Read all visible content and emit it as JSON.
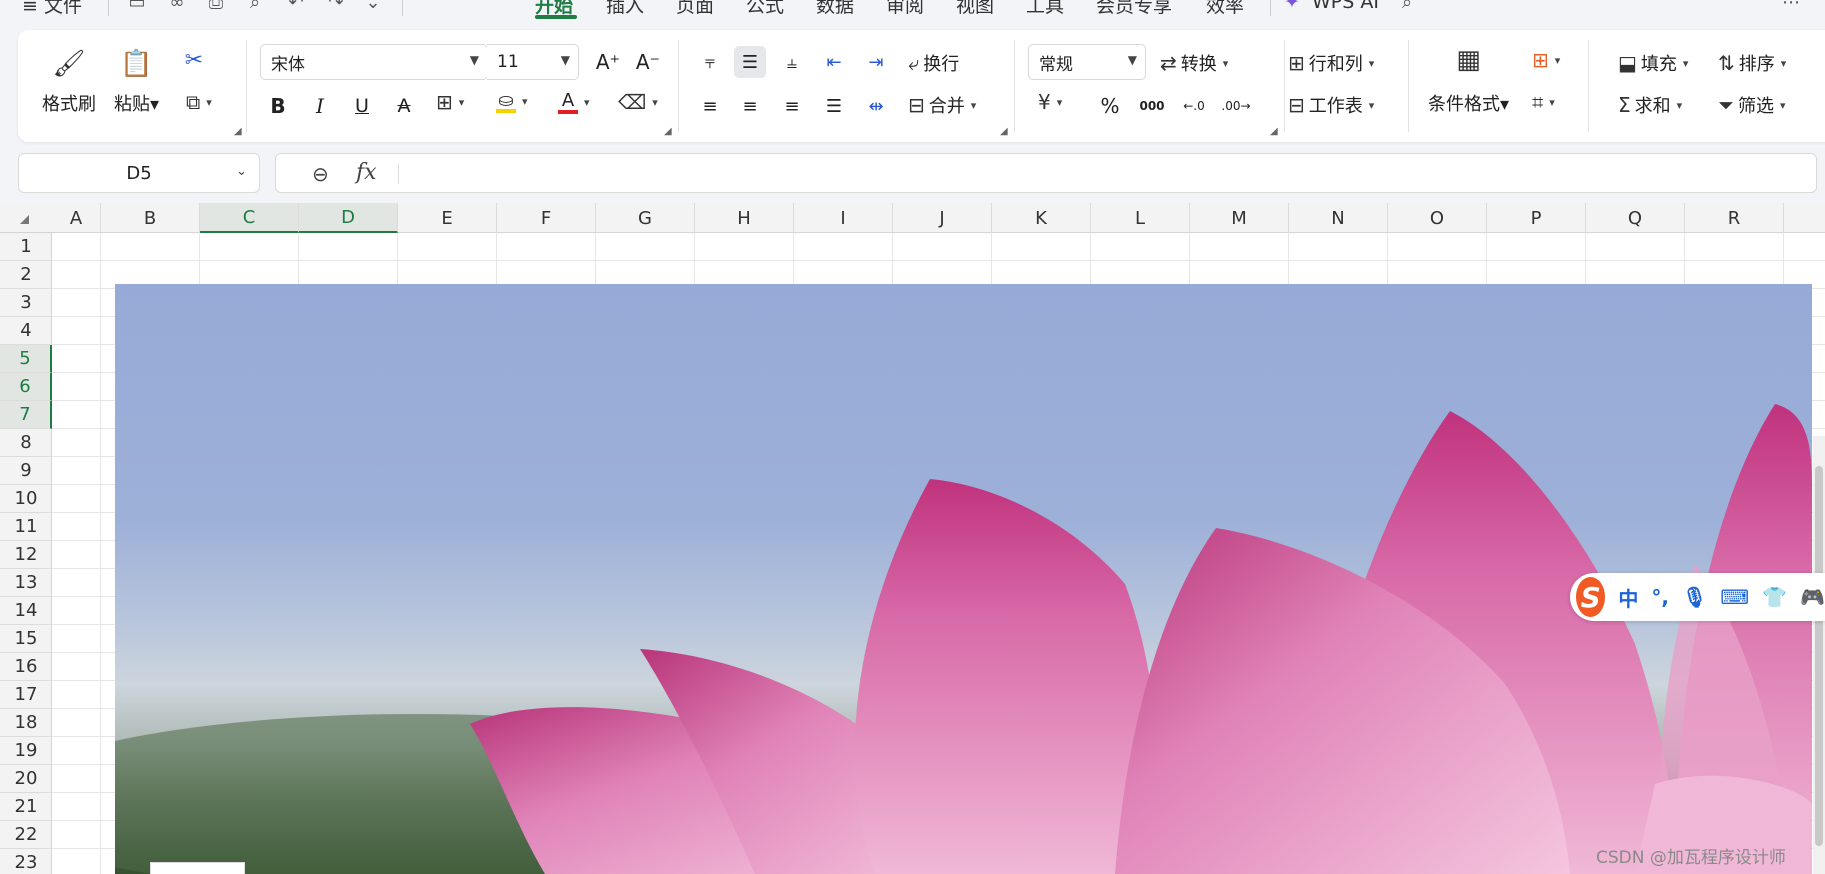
{
  "menubar": {
    "file": "≡ 文件",
    "tabs": [
      "开始",
      "插入",
      "页面",
      "公式",
      "数据",
      "审阅",
      "视图",
      "工具",
      "会员专享",
      "效率"
    ],
    "active_tab": "开始",
    "wps_ai": "WPS AI"
  },
  "ribbon": {
    "format_painter": "格式刷",
    "paste": "粘贴",
    "font_name": "宋体",
    "font_size": "11",
    "wrap": "换行",
    "merge": "合并",
    "number_format": "常规",
    "convert": "转换",
    "row_col": "行和列",
    "worksheet": "工作表",
    "cond_format": "条件格式",
    "fill": "填充",
    "sort": "排序",
    "sum": "求和",
    "filter": "筛选",
    "currency_symbol": "¥",
    "percent_symbol": "%",
    "thousands_symbol": "000"
  },
  "formula_bar": {
    "name_box": "D5",
    "fx": "fx",
    "value": ""
  },
  "grid": {
    "columns": [
      "A",
      "B",
      "C",
      "D",
      "E",
      "F",
      "G",
      "H",
      "I",
      "J",
      "K",
      "L",
      "M",
      "N",
      "O",
      "P",
      "Q",
      "R"
    ],
    "selected_columns": [
      "C",
      "D"
    ],
    "rows": [
      "1",
      "2",
      "3",
      "4",
      "5",
      "6",
      "7",
      "8",
      "9",
      "10",
      "11",
      "12",
      "13",
      "14",
      "15",
      "16",
      "17",
      "18",
      "19",
      "20",
      "21",
      "22",
      "23"
    ],
    "selected_rows": [
      "5",
      "6",
      "7"
    ]
  },
  "ime": {
    "logo": "S",
    "mode": "中",
    "punct": "°,"
  },
  "watermark": "CSDN @加瓦程序设计师",
  "colors": {
    "accent_green": "#1e7d43",
    "font_color_red": "#e02020",
    "highlight_yellow": "#f5d100",
    "ime_blue": "#1b64d8",
    "ime_orange": "#f15a24"
  }
}
